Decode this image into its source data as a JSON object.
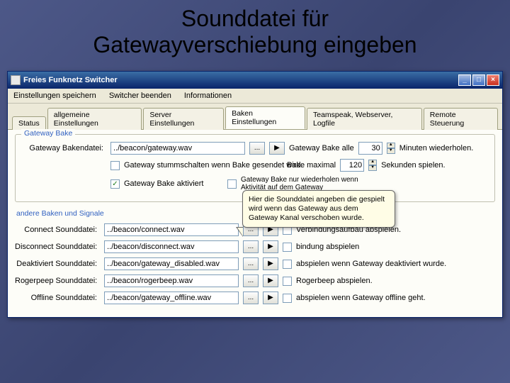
{
  "slide": {
    "title_line1": "Sounddatei für",
    "title_line2": "Gatewayverschiebung eingeben"
  },
  "window": {
    "title": "Freies Funknetz Switcher",
    "min": "_",
    "max": "□",
    "close": "×"
  },
  "menu": {
    "save": "Einstellungen speichern",
    "quit": "Switcher beenden",
    "info": "Informationen"
  },
  "tabs": {
    "status": "Status",
    "general": "allgemeine Einstellungen",
    "server": "Server Einstellungen",
    "beacon": "Baken Einstellungen",
    "ts": "Teamspeak, Webserver, Logfile",
    "remote": "Remote Steuerung"
  },
  "groups": {
    "gatewayBake": "Gateway Bake",
    "otherSignals": "andere Baken und Signale"
  },
  "gatewayBake": {
    "fileLabel": "Gateway Bakendatei:",
    "file": "../beacon/gateway.wav",
    "btnBrowse": "...",
    "btnPlay": "▶",
    "everyLabel": "Gateway Bake alle",
    "every": "30",
    "everyUnit": "Minuten wiederholen.",
    "muteLabel": "Gateway stummschalten wenn Bake gesendet wird.",
    "maxLabel": "Bake maximal",
    "max": "120",
    "maxUnit": "Sekunden spielen.",
    "activeLabel": "Gateway Bake aktiviert",
    "repeatLabel1": "Gateway Bake nur wiederholen wenn",
    "repeatLabel2": "Aktivität auf dem Gateway"
  },
  "signals": {
    "connect": {
      "label": "Connect Sounddatei:",
      "file": "../beacon/connect.wav",
      "suffix": "Verbindungsaufbau abspielen."
    },
    "disconnect": {
      "label": "Disconnect Sounddatei:",
      "file": "../beacon/disconnect.wav",
      "suffix": "bindung abspielen"
    },
    "disabled": {
      "label": "Deaktiviert Sounddatei:",
      "file": "../beacon/gateway_disabled.wav",
      "suffix": "abspielen wenn Gateway deaktiviert wurde."
    },
    "roger": {
      "label": "Rogerpeep Sounddatei:",
      "file": "../beacon/rogerbeep.wav",
      "suffix": "Rogerbeep abspielen."
    },
    "offline": {
      "label": "Offline Sounddatei:",
      "file": "../beacon/gateway_offline.wav",
      "suffix": "abspielen wenn Gateway offline geht."
    }
  },
  "callout": {
    "text": "Hier die Sounddatei angeben die gespielt wird wenn das Gateway aus dem Gateway Kanal verschoben wurde."
  }
}
